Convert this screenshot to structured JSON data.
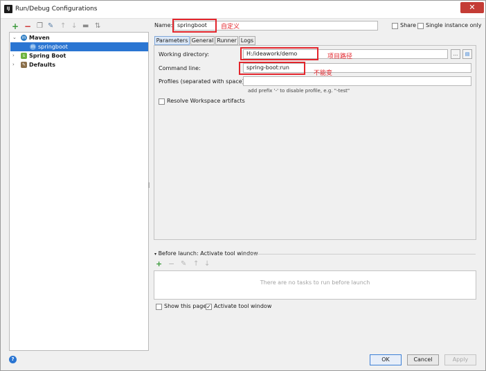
{
  "window": {
    "title": "Run/Debug Configurations",
    "close_glyph": "✕"
  },
  "left_toolbar": {
    "icons": [
      "add-icon",
      "remove-icon",
      "copy-icon",
      "edit-defaults-icon",
      "move-up-icon",
      "move-down-icon",
      "folder-icon",
      "sort-icon"
    ],
    "glyphs": [
      "+",
      "−",
      "❐",
      "✎",
      "↑",
      "↓",
      "▬",
      "⇅"
    ]
  },
  "tree": {
    "items": [
      {
        "label": "Maven",
        "expanded": true
      },
      {
        "label": "springboot",
        "selected": true
      },
      {
        "label": "Spring Boot",
        "expanded": false
      },
      {
        "label": "Defaults",
        "expanded": false
      }
    ]
  },
  "config": {
    "name_label": "Name:",
    "name_value": "springboot",
    "share_label": "Share",
    "single_instance_label": "Single instance only",
    "tabs": [
      {
        "label": "Parameters",
        "active": true
      },
      {
        "label": "General",
        "active": false
      },
      {
        "label": "Runner",
        "active": false
      },
      {
        "label": "Logs",
        "active": false
      }
    ],
    "working_dir_label": "Working directory:",
    "working_dir_value": "H:/ideawork/demo",
    "browse_label": "...",
    "command_line_label": "Command line:",
    "command_line_value": "spring-boot:run",
    "profiles_label": "Profiles (separated with space):",
    "profiles_value": "",
    "profiles_hint": "add prefix '-' to disable profile, e.g. \"-test\"",
    "resolve_workspace_label": "Resolve Workspace artifacts"
  },
  "annotations": {
    "name_note": "自定义",
    "workdir_note": "项目路径",
    "cmdline_note": "不能变"
  },
  "before_launch": {
    "heading": "Before launch: Activate tool window",
    "toolbar_glyphs": [
      "+",
      "−",
      "✎",
      "↑",
      "↓"
    ],
    "empty_text": "There are no tasks to run before launch",
    "show_page_label": "Show this page",
    "activate_tool_window_label": "Activate tool window"
  },
  "footer": {
    "help_glyph": "?",
    "ok_label": "OK",
    "cancel_label": "Cancel",
    "apply_label": "Apply"
  },
  "colors": {
    "selection": "#2a75d2",
    "annotation": "#e3242b",
    "add": "#3a9a3a",
    "remove": "#cc2a2a"
  }
}
